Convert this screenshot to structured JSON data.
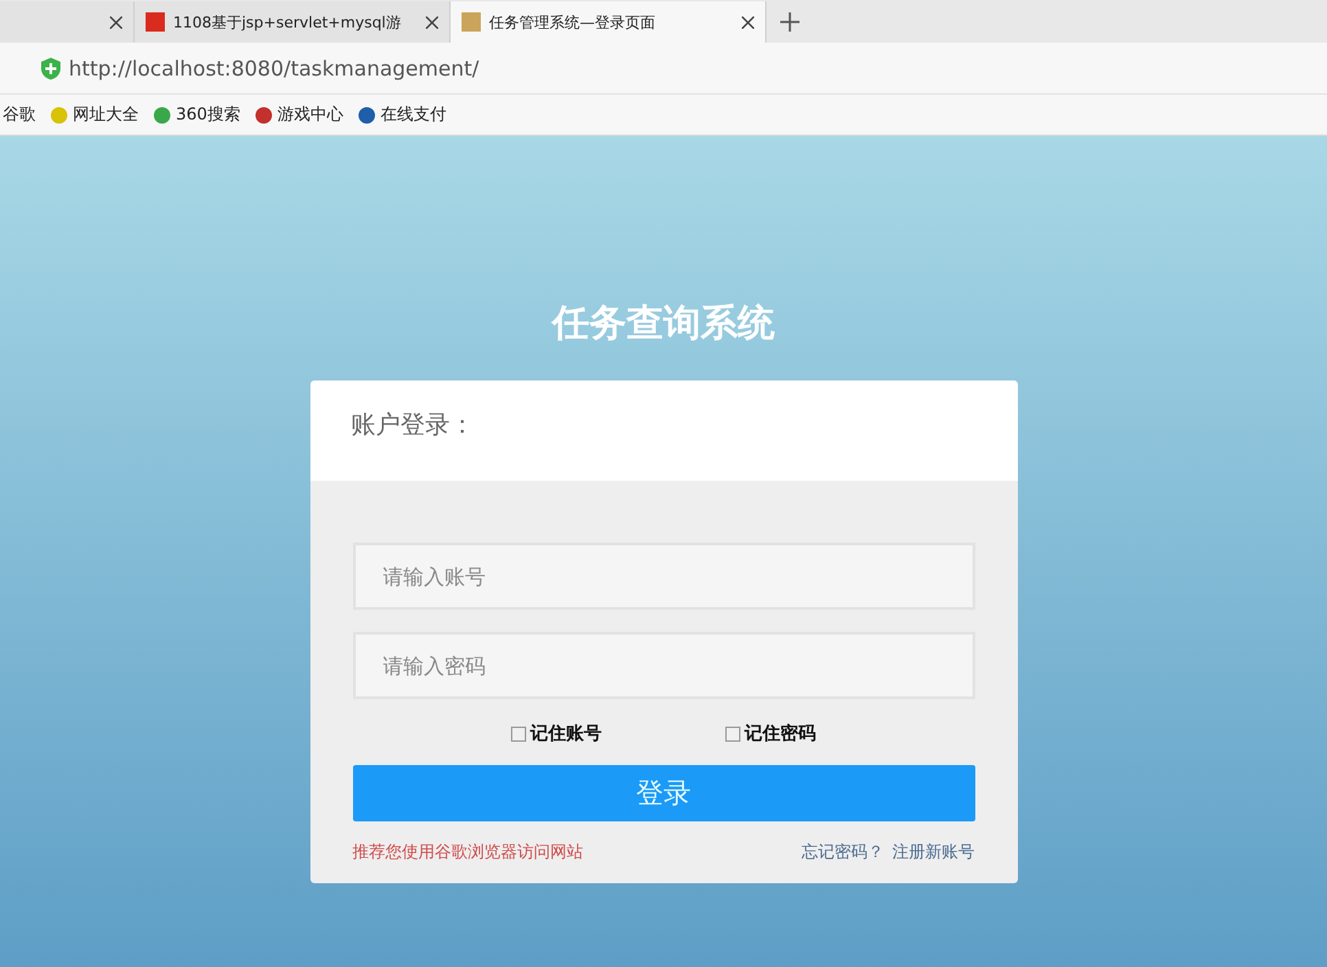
{
  "browser": {
    "tabs": [
      {
        "selected": false
      },
      {
        "title": "1108基于jsp+servlet+mysql游",
        "selected": false
      },
      {
        "title": "任务管理系统—登录页面",
        "selected": true
      }
    ],
    "address": "http://localhost:8080/taskmanagement/",
    "bookmarks": [
      "谷歌",
      "网址大全",
      "360搜索",
      "游戏中心",
      "在线支付"
    ]
  },
  "page": {
    "title": "任务查询系统",
    "card_heading": "账户登录：",
    "fields": [
      {
        "placeholder": "请输入账号"
      },
      {
        "placeholder": "请输入密码"
      }
    ],
    "options": [
      {
        "label": "记住账号",
        "checked": false
      },
      {
        "label": "记住密码",
        "checked": false
      }
    ],
    "login_button": "登录",
    "notice": "推荐您使用谷歌浏览器访问网站",
    "links": [
      "忘记密码？",
      "注册新账号"
    ]
  }
}
